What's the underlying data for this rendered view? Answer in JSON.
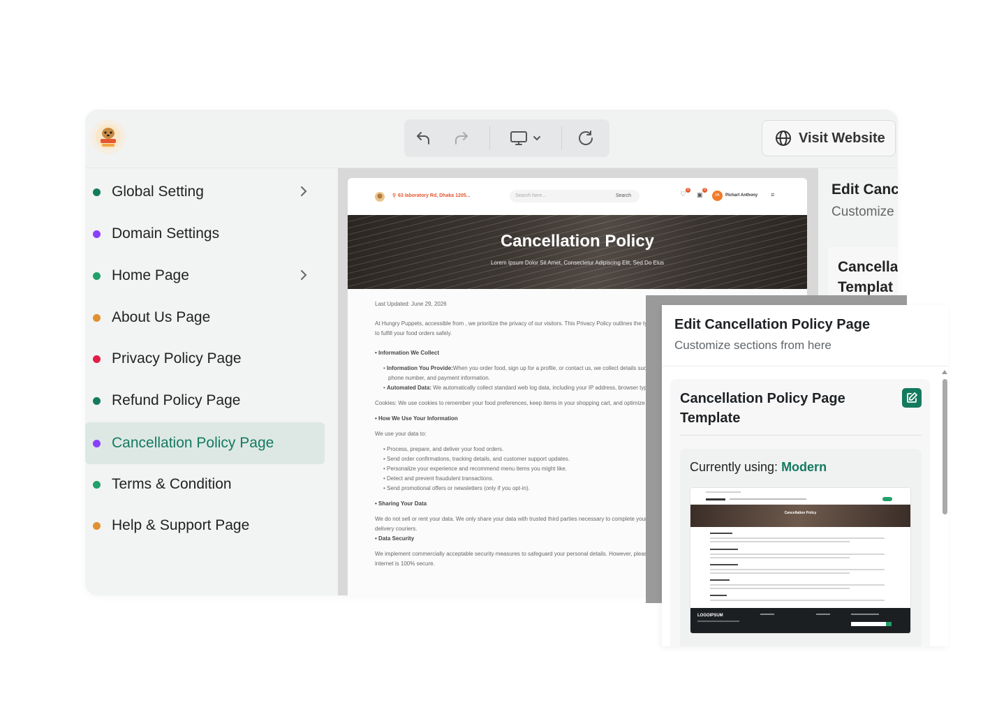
{
  "toolbar": {
    "visit_label": "Visit Website",
    "undo_icon": "undo-icon",
    "redo_icon": "redo-icon",
    "device_icon": "desktop-icon",
    "refresh_icon": "refresh-icon"
  },
  "sidebar": {
    "items": [
      {
        "label": "Global Setting",
        "dot": "#147a5e",
        "chevron": true
      },
      {
        "label": "Domain Settings",
        "dot": "#8a3ffc",
        "chevron": false
      },
      {
        "label": "Home Page",
        "dot": "#22a06b",
        "chevron": true
      },
      {
        "label": "About Us Page",
        "dot": "#e0912f",
        "chevron": false
      },
      {
        "label": "Privacy Policy Page",
        "dot": "#e11d48",
        "chevron": false
      },
      {
        "label": "Refund Policy Page",
        "dot": "#147a5e",
        "chevron": false
      },
      {
        "label": "Cancellation Policy Page",
        "dot": "#8a3ffc",
        "chevron": false,
        "active": true
      },
      {
        "label": "Terms & Condition",
        "dot": "#22a06b",
        "chevron": false
      },
      {
        "label": "Help & Support Page",
        "dot": "#e0912f",
        "chevron": false
      }
    ]
  },
  "preview": {
    "address": "63 laboratory Rd, Dhaka 1205...",
    "search_placeholder": "Search here...",
    "search_label": "Search",
    "user_initials": "PA",
    "user_name": "Pichart Anthony",
    "badge_count_1": "0",
    "badge_count_2": "0",
    "hero_title": "Cancellation Policy",
    "hero_sub": "Lorem Ipsum Dolor Sit Amet, Consectetur Adipiscing Elit, Sed Do Eius",
    "last_updated": "Last Updated: June 29, 2026",
    "intro": "At Hungry Puppets, accessible from , we prioritize the privacy of our visitors. This Privacy Policy outlines the typ",
    "intro2": "to fulfill your food orders safely.",
    "h1": "• Information We Collect",
    "b1a_bold": "Information You Provide:",
    "b1a": "When you order food, sign up for a profile, or contact us, we collect details such as",
    "b1a2": "phone number, and payment information.",
    "b1b_bold": "Automated Data:",
    "b1b": " We automatically collect standard web log data, including your IP address, browser type,",
    "cookies": "Cookies: We use cookies to remember your food preferences, keep items in your shopping cart, and optimize yo",
    "h2": "• How We Use Your Information",
    "use_intro": "We use your data to:",
    "uses": [
      "Process, prepare, and deliver your food orders.",
      "Send order confirmations, tracking details, and customer support updates.",
      "Personalize your experience and recommend menu items you might like.",
      "Detect and prevent fraudulent transactions.",
      "Send promotional offers or newsletters (only if you opt-in)."
    ],
    "h3": "• Sharing Your Data",
    "share": "We do not sell or rent your data. We only share your data with trusted third parties necessary to complete your o",
    "share2": "delivery couriers.",
    "h4": "• Data Security",
    "security": "We implement commercially acceptable security measures to safeguard your personal details. However, please re",
    "security2": "internet is 100% secure."
  },
  "right_panel": {
    "title": "Edit Canc",
    "sub": "Customize",
    "card_title_1": "Cancella",
    "card_title_2": "Templat"
  },
  "popup": {
    "title": "Edit Cancellation Policy Page",
    "sub": "Customize sections from here",
    "card_title_1": "Cancellation Policy Page",
    "card_title_2": "Template",
    "using_prefix": "Currently using: ",
    "using_value": "Modern",
    "thumb_title": "Cancellation Policy",
    "thumb_logo": "LOGOIPSUM"
  },
  "colors": {
    "accent": "#147a5e"
  }
}
